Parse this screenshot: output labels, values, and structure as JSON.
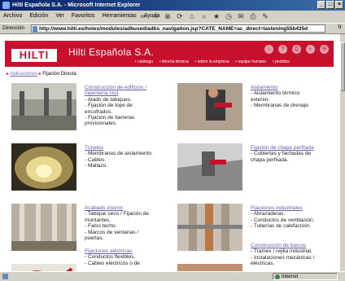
{
  "window": {
    "title": "Hilti Española S.A. - Microsoft Internet Explorer",
    "controls": [
      "_",
      "□",
      "×"
    ]
  },
  "menu": {
    "items": [
      "Archivo",
      "Edición",
      "Ver",
      "Favoritos",
      "Herramientas",
      "Ayuda"
    ],
    "toolbar_icons": [
      "back-icon",
      "forward-icon",
      "stop-icon",
      "refresh-icon",
      "home-icon",
      "search-icon",
      "favorites-icon",
      "history-icon",
      "mail-icon",
      "print-icon",
      "edit-icon"
    ]
  },
  "address": {
    "label": "Dirección",
    "url": "http://www.hilti.es/holes/modules/adbused/adbs_navigation.jsp?CATE_NAME=ac_direct=lastening55b435d",
    "go": "Ir"
  },
  "site": {
    "logo": "HILTI",
    "title": "Hilti Española S.A.",
    "nav": [
      "• catálogo",
      "• librería técnica",
      "• sobre la empresa",
      "• equipo humano",
      "• pedidos"
    ],
    "header_icons": [
      "home-icon",
      "help-icon",
      "print-icon",
      "search-icon",
      "mail-icon"
    ]
  },
  "breadcrumb": {
    "link": "Aplicaciones",
    "current": "Fijación Directa"
  },
  "categories": [
    {
      "title_lines": [
        "Construcción de edificios /",
        "ingeniería civil"
      ],
      "lines": [
        "- Atado de tabiques.",
        "- Fijación de tope de",
        "  encofrados.",
        "- Fijación de barreras",
        "  provisionales."
      ]
    },
    {
      "title_lines": [
        "Aislamiento"
      ],
      "lines": [
        "- Aislamiento térmico",
        "  exterior.",
        "- Membranas de drenaje."
      ]
    },
    {
      "title_lines": [
        "Túneles"
      ],
      "lines": [
        "- Membranas de aislamiento.",
        "- Cables.",
        "- Mallazo."
      ]
    },
    {
      "title_lines": [
        "Fijación de chapa perfilada"
      ],
      "lines": [
        "- Cubiertas y fachadas de",
        "  chapa perfilada."
      ]
    },
    {
      "title_lines": [
        "Acabado interior"
      ],
      "lines": [
        "- Tabique seco / Fijación de",
        "  montantes.",
        "- Falso techo.",
        "- Marcos de ventanas /",
        "  puertas."
      ]
    },
    {
      "title_lines": [
        "Fijaciones industriales"
      ],
      "lines": [
        "- Abrazaderas.",
        "- Conductos de ventilación.",
        "- Tuberías de calefacción."
      ]
    },
    {
      "title_lines": [
        "Fijaciones eléctricas"
      ],
      "lines": [
        "- Conductos flexibles.",
        "- Cables eléctricos o de"
      ]
    },
    {
      "title_lines": [
        "Construcción de barcos"
      ],
      "lines": [
        "- Tramex / rejilla industrial.",
        "- Instalaciones mecánicas /",
        "  eléctricas."
      ]
    }
  ],
  "status": {
    "zone": "Internet"
  },
  "colors": {
    "brand_red": "#c8102e",
    "link": "#6a5ab0"
  }
}
